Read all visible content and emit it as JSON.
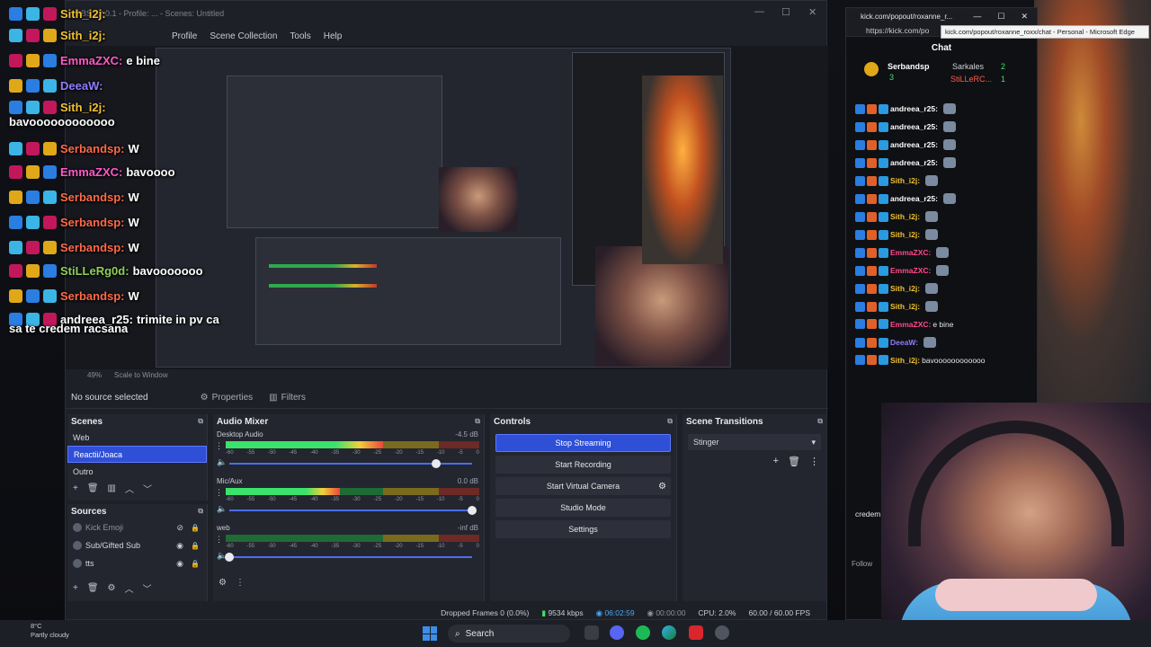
{
  "obs": {
    "title": "OBS 32.0.1 - Profile: ... - Scenes: Untitled",
    "menu": [
      "Profile",
      "Scene Collection",
      "Tools",
      "Help"
    ],
    "zoom": "49%",
    "scale_mode": "Scale to Window",
    "no_source": "No source selected",
    "properties": "Properties",
    "filters": "Filters"
  },
  "scenes": {
    "title": "Scenes",
    "items": [
      "Web",
      "Reactii/Joaca",
      "Outro"
    ],
    "active": 1
  },
  "sources": {
    "title": "Sources",
    "items": [
      "Kick Emoji",
      "Sub/Gifted Sub",
      "tts"
    ]
  },
  "mixer": {
    "title": "Audio Mixer",
    "channels": [
      {
        "name": "Desktop Audio",
        "db": "-4.5 dB",
        "level": 0.62,
        "volume": 0.85
      },
      {
        "name": "Mic/Aux",
        "db": "0.0 dB",
        "level": 0.45,
        "volume": 1.0
      },
      {
        "name": "web",
        "db": "-inf dB",
        "level": 0.0,
        "volume": 0.0
      }
    ],
    "ticks": [
      "-60",
      "-55",
      "-50",
      "-45",
      "-40",
      "-35",
      "-30",
      "-25",
      "-20",
      "-15",
      "-10",
      "-5",
      "0"
    ]
  },
  "controls": {
    "title": "Controls",
    "buttons": [
      "Stop Streaming",
      "Start Recording",
      "Start Virtual Camera",
      "Studio Mode",
      "Settings"
    ]
  },
  "transitions": {
    "title": "Scene Transitions",
    "selected": "Stinger"
  },
  "status": {
    "dropped": "Dropped Frames 0 (0.0%)",
    "bitrate": "9534 kbps",
    "live_time": "06:02:59",
    "rec_time": "00:00:00",
    "cpu": "CPU: 2.0%",
    "fps": "60.00 / 60.00 FPS"
  },
  "overlay": [
    {
      "name": "Sith_i2j:",
      "msg": "",
      "color": "#f1c232"
    },
    {
      "name": "Sith_i2j:",
      "msg": "",
      "color": "#f1c232"
    },
    {
      "name": "EmmaZXC:",
      "msg": "e bine",
      "color": "#ff5ac8"
    },
    {
      "name": "DeeaW:",
      "msg": "",
      "color": "#8f7cff"
    },
    {
      "name": "Sith_i2j:",
      "msg": "bavoooooooooooo",
      "color": "#f1c232"
    },
    {
      "name": "Serbandsp:",
      "msg": "W",
      "color": "#ff6a4a"
    },
    {
      "name": "EmmaZXC:",
      "msg": "bavoooo",
      "color": "#ff5ac8"
    },
    {
      "name": "Serbandsp:",
      "msg": "W",
      "color": "#ff6a4a"
    },
    {
      "name": "Serbandsp:",
      "msg": "W",
      "color": "#ff6a4a"
    },
    {
      "name": "Serbandsp:",
      "msg": "W",
      "color": "#ff6a4a"
    },
    {
      "name": "StiLLeRg0d:",
      "msg": "bavooooooo",
      "color": "#8fcf5a"
    },
    {
      "name": "Serbandsp:",
      "msg": "W",
      "color": "#ff6a4a"
    },
    {
      "name": "andreea_r25:",
      "msg": "trimite in pv ca",
      "color": "#ffffff"
    }
  ],
  "overlay_wrap": "sa te credem racsana",
  "edge": {
    "tab_title": "kick.com/popout/roxanne_r...",
    "url": "https://kick.com/po",
    "tooltip": "kick.com/popout/roxanne_roxx/chat - Personal - Microsoft Edge",
    "chat_title": "Chat",
    "pinned": [
      {
        "name": "Serbandsp",
        "count": "3"
      },
      {
        "name": "Sarkales",
        "count": "2"
      },
      {
        "name": "StiLLeRC...",
        "count": "1"
      }
    ],
    "messages": [
      {
        "name": "andreea_r25:",
        "msg": "",
        "color": "#ffffff"
      },
      {
        "name": "andreea_r25:",
        "msg": "",
        "color": "#ffffff"
      },
      {
        "name": "andreea_r25:",
        "msg": "",
        "color": "#ffffff"
      },
      {
        "name": "andreea_r25:",
        "msg": "",
        "color": "#ffffff"
      },
      {
        "name": "Sith_i2j:",
        "msg": "",
        "color": "#f1c232"
      },
      {
        "name": "andreea_r25:",
        "msg": "",
        "color": "#ffffff"
      },
      {
        "name": "Sith_i2j:",
        "msg": "",
        "color": "#f1c232"
      },
      {
        "name": "Sith_i2j:",
        "msg": "",
        "color": "#f1c232"
      },
      {
        "name": "EmmaZXC:",
        "msg": "",
        "color": "#ff4a8a"
      },
      {
        "name": "EmmaZXC:",
        "msg": "",
        "color": "#ff4a8a"
      },
      {
        "name": "Sith_i2j:",
        "msg": "",
        "color": "#f1c232"
      },
      {
        "name": "Sith_i2j:",
        "msg": "",
        "color": "#f1c232"
      },
      {
        "name": "EmmaZXC:",
        "msg": "e bine",
        "color": "#ff4a8a"
      },
      {
        "name": "DeeaW:",
        "msg": "",
        "color": "#8f7cff"
      },
      {
        "name": "Sith_i2j:",
        "msg": "bavoooooooooooo",
        "color": "#f1c232"
      }
    ],
    "wrap_text": "credem",
    "follow": "Follow"
  },
  "taskbar": {
    "temp": "8°C",
    "weather": "Partly cloudy",
    "search": "Search"
  }
}
